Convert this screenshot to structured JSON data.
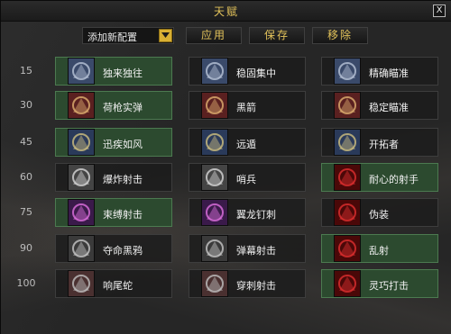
{
  "window": {
    "title": "天赋",
    "close_label": "X"
  },
  "toolbar": {
    "config_select": "添加新配置",
    "apply_label": "应用",
    "save_label": "保存",
    "remove_label": "移除"
  },
  "rows": [
    {
      "level": "15",
      "talents": [
        {
          "name": "独来独往",
          "selected": true,
          "icon": "wolf-howl-icon"
        },
        {
          "name": "稳固集中",
          "selected": false,
          "icon": "feather-icon"
        },
        {
          "name": "精确瞄准",
          "selected": false,
          "icon": "aim-icon"
        }
      ]
    },
    {
      "level": "30",
      "talents": [
        {
          "name": "荷枪实弹",
          "selected": true,
          "icon": "loaded-gun-icon"
        },
        {
          "name": "黑箭",
          "selected": false,
          "icon": "black-arrow-icon"
        },
        {
          "name": "稳定瞄准",
          "selected": false,
          "icon": "steady-aim-icon"
        }
      ]
    },
    {
      "level": "45",
      "talents": [
        {
          "name": "迅疾如风",
          "selected": true,
          "icon": "boots-icon"
        },
        {
          "name": "远遁",
          "selected": false,
          "icon": "cloak-icon"
        },
        {
          "name": "开拓者",
          "selected": false,
          "icon": "trailblazer-icon"
        }
      ]
    },
    {
      "level": "60",
      "talents": [
        {
          "name": "爆炸射击",
          "selected": false,
          "icon": "explosive-shot-icon"
        },
        {
          "name": "哨兵",
          "selected": false,
          "icon": "sentinel-icon"
        },
        {
          "name": "耐心的射手",
          "selected": true,
          "icon": "target-eye-icon"
        }
      ]
    },
    {
      "level": "75",
      "talents": [
        {
          "name": "束缚射击",
          "selected": true,
          "icon": "binding-shot-icon"
        },
        {
          "name": "翼龙钉刺",
          "selected": false,
          "icon": "wyvern-sting-icon"
        },
        {
          "name": "伪装",
          "selected": false,
          "icon": "camouflage-icon"
        }
      ]
    },
    {
      "level": "90",
      "talents": [
        {
          "name": "夺命黑鸦",
          "selected": false,
          "icon": "crow-icon"
        },
        {
          "name": "弹幕射击",
          "selected": false,
          "icon": "barrage-icon"
        },
        {
          "name": "乱射",
          "selected": true,
          "icon": "volley-icon"
        }
      ]
    },
    {
      "level": "100",
      "talents": [
        {
          "name": "响尾蛇",
          "selected": false,
          "icon": "rattlesnake-icon"
        },
        {
          "name": "穿刺射击",
          "selected": false,
          "icon": "piercing-shot-icon"
        },
        {
          "name": "灵巧打击",
          "selected": true,
          "icon": "trick-shot-icon"
        }
      ]
    }
  ],
  "colors": {
    "selected_bg": "#2c4a2f",
    "gold_text": "#e2c25a"
  }
}
